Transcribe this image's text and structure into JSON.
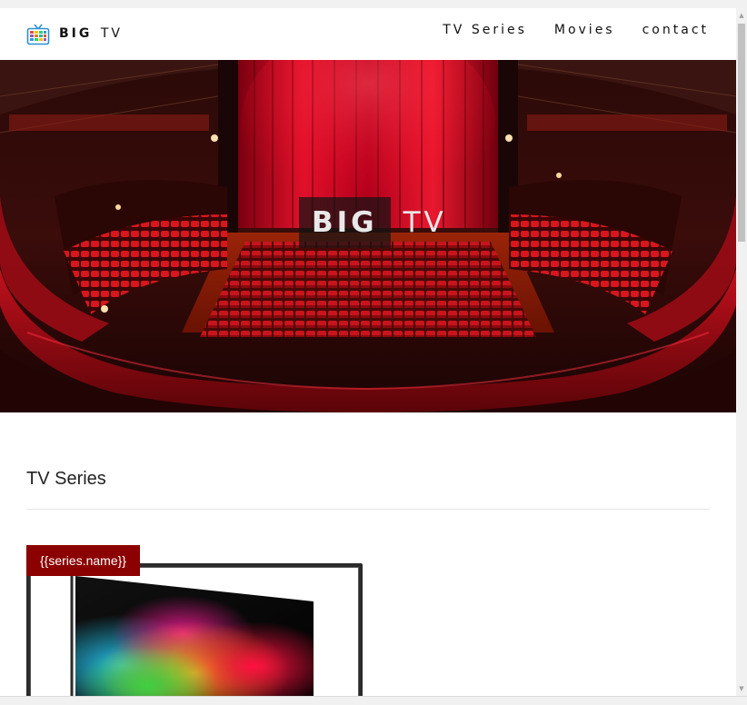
{
  "brand": {
    "bold": "BIG",
    "light": "TV",
    "icon": "tv-icon"
  },
  "nav": {
    "items": [
      {
        "label": "TV Series"
      },
      {
        "label": "Movies"
      },
      {
        "label": "contact"
      }
    ]
  },
  "hero": {
    "title_bold": "BIG",
    "title_light": "TV"
  },
  "section": {
    "title": "TV Series"
  },
  "cards": [
    {
      "badge": "{{series.name}}"
    }
  ],
  "colors": {
    "accent": "#8b0000",
    "theatre_red": "#c0001a"
  }
}
